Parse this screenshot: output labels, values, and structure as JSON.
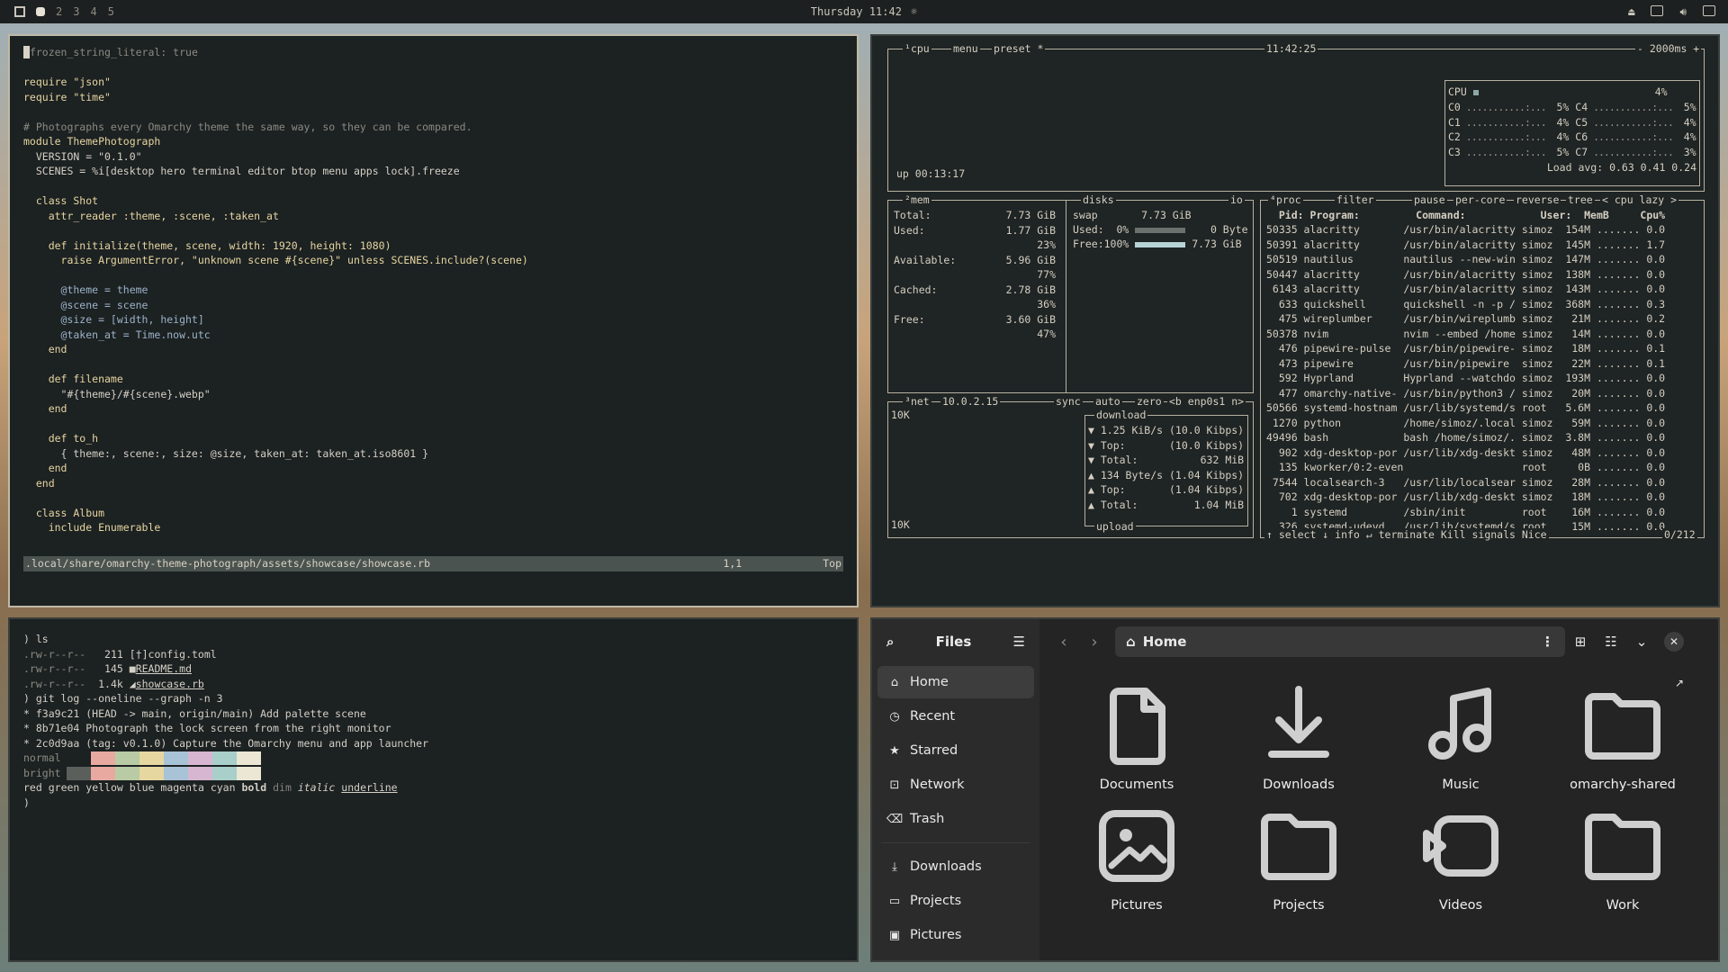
{
  "topbar": {
    "workspaces": [
      "2",
      "3",
      "4",
      "5"
    ],
    "clock": "Thursday 11:42"
  },
  "editor": {
    "lines": [
      "frozen_string_literal: true",
      "",
      "require \"json\"",
      "require \"time\"",
      "",
      "# Photographs every Omarchy theme the same way, so they can be compared.",
      "module ThemePhotograph",
      "  VERSION = \"0.1.0\"",
      "  SCENES = %i[desktop hero terminal editor btop menu apps lock].freeze",
      "",
      "  class Shot",
      "    attr_reader :theme, :scene, :taken_at",
      "",
      "    def initialize(theme, scene, width: 1920, height: 1080)",
      "      raise ArgumentError, \"unknown scene #{scene}\" unless SCENES.include?(scene)",
      "",
      "      @theme = theme",
      "      @scene = scene",
      "      @size = [width, height]",
      "      @taken_at = Time.now.utc",
      "    end",
      "",
      "    def filename",
      "      \"#{theme}/#{scene}.webp\"",
      "    end",
      "",
      "    def to_h",
      "      { theme:, scene:, size: @size, taken_at: taken_at.iso8601 }",
      "    end",
      "  end",
      "",
      "  class Album",
      "    include Enumerable"
    ],
    "status_path": ".local/share/omarchy-theme-photograph/assets/showcase/showcase.rb",
    "status_pos": "1,1",
    "status_scroll": "Top"
  },
  "btop": {
    "cpu": {
      "title": "cpu",
      "menu": "menu",
      "preset": "preset *",
      "time": "11:42:25",
      "interval": "- 2000ms +",
      "uptime": "up 00:13:17",
      "total_label": "CPU",
      "total": "4%",
      "cores": [
        {
          "name": "C0",
          "val": "5%"
        },
        {
          "name": "C4",
          "val": "5%"
        },
        {
          "name": "C1",
          "val": "4%"
        },
        {
          "name": "C5",
          "val": "4%"
        },
        {
          "name": "C2",
          "val": "4%"
        },
        {
          "name": "C6",
          "val": "4%"
        },
        {
          "name": "C3",
          "val": "5%"
        },
        {
          "name": "C7",
          "val": "3%"
        }
      ],
      "load": "Load avg: 0.63 0.41 0.24"
    },
    "mem": {
      "title": "mem",
      "disks": "disks",
      "io": "io",
      "rows": [
        "Total:            7.73 GiB",
        "Used:             1.77 GiB",
        "                       23%",
        "Available:        5.96 GiB",
        "                       77%",
        "Cached:           2.78 GiB",
        "                       36%",
        "Free:             3.60 GiB",
        "                       47%"
      ],
      "swap_title": "swap",
      "swap_total": "7.73 GiB",
      "swap_used": "Used:  0%",
      "swap_used_val": "0 Byte",
      "swap_free": "Free:100%",
      "swap_free_val": "7.73 GiB"
    },
    "net": {
      "title": "net",
      "ip": "10.0.2.15",
      "sync": "sync",
      "auto": "auto",
      "zero": "zero",
      "iface": "<b enp0s1 n>",
      "scale_top": "10K",
      "scale_bottom": "10K",
      "download": "download",
      "upload": "upload",
      "rows": [
        "▼ 1.25 KiB/s (10.0 Kibps)",
        "▼ Top:       (10.0 Kibps)",
        "▼ Total:          632 MiB",
        "▲ 134 Byte/s (1.04 Kibps)",
        "▲ Top:       (1.04 Kibps)",
        "▲ Total:         1.04 MiB"
      ]
    },
    "proc": {
      "title": "proc",
      "filter": "filter",
      "pause": "pause",
      "percore": "per-core",
      "reverse": "reverse",
      "tree": "tree",
      "sort": "< cpu lazy >",
      "header": "  Pid: Program:         Command:            User:  MemB     Cpu%",
      "rows": [
        "50335 alacritty       /usr/bin/alacritty simoz  154M ....... 0.0",
        "50391 alacritty       /usr/bin/alacritty simoz  145M ....... 1.7",
        "50519 nautilus        nautilus --new-win simoz  147M ....... 0.0",
        "50447 alacritty       /usr/bin/alacritty simoz  138M ....... 0.0",
        " 6143 alacritty       /usr/bin/alacritty simoz  143M ....... 0.0",
        "  633 quickshell      quickshell -n -p / simoz  368M ....... 0.3",
        "  475 wireplumber     /usr/bin/wireplumb simoz   21M ....... 0.2",
        "50378 nvim            nvim --embed /home simoz   14M ....... 0.0",
        "  476 pipewire-pulse  /usr/bin/pipewire- simoz   18M ....... 0.1",
        "  473 pipewire        /usr/bin/pipewire  simoz   22M ....... 0.1",
        "  592 Hyprland        Hyprland --watchdo simoz  193M ....... 0.0",
        "  477 omarchy-native- /usr/bin/python3 / simoz   20M ....... 0.0",
        "50566 systemd-hostnam /usr/lib/systemd/s root   5.6M ....... 0.0",
        " 1270 python          /home/simoz/.local simoz   59M ....... 0.0",
        "49496 bash            bash /home/simoz/. simoz  3.8M ....... 0.0",
        "  902 xdg-desktop-por /usr/lib/xdg-deskt simoz   48M ....... 0.0",
        "  135 kworker/0:2-even                   root     0B ....... 0.0",
        " 7544 localsearch-3   /usr/lib/localsear simoz   28M ....... 0.0",
        "  702 xdg-desktop-por /usr/lib/xdg-deskt simoz   18M ....... 0.0",
        "    1 systemd         /sbin/init         root    16M ....... 0.0",
        "  326 systemd-udevd   /usr/lib/systemd/s root    15M ....... 0.0"
      ],
      "footer": "↑ select ↓ info ↵ terminate  Kill  signals  Nice",
      "count": "0/212"
    }
  },
  "terminal": {
    "prompt1": ") ls",
    "ls": [
      {
        "perm": ".rw-r--r--",
        "size": "211",
        "icon": "[†]",
        "name": "config.toml"
      },
      {
        "perm": ".rw-r--r--",
        "size": "145",
        "icon": "■",
        "name": "README.md"
      },
      {
        "perm": ".rw-r--r--",
        "size": "1.4k",
        "icon": "◢",
        "name": "showcase.rb"
      }
    ],
    "prompt2": ") git log --oneline --graph -n 3",
    "log": [
      "* f3a9c21 (HEAD -> main, origin/main) Add palette scene",
      "* 8b71e04 Photograph the lock screen from the right monitor",
      "* 2c0d9aa (tag: v0.1.0) Capture the Omarchy menu and app launcher"
    ],
    "normal_label": "normal",
    "bright_label": "bright",
    "palette_normal": [
      "#1c2122",
      "#e8a9a0",
      "#b8cba4",
      "#e6d6a0",
      "#a9c3d6",
      "#d6b6d0",
      "#a8cfc9",
      "#ece6d4"
    ],
    "palette_bright": [
      "#5a5f5b",
      "#e8a9a0",
      "#b8cba4",
      "#e6d6a0",
      "#a9c3d6",
      "#d6b6d0",
      "#a8cfc9",
      "#ece6d4"
    ],
    "styles": [
      "red",
      "green",
      "yellow",
      "blue",
      "magenta",
      "cyan",
      "bold",
      "dim",
      "italic",
      "underline"
    ],
    "prompt3": ")"
  },
  "files": {
    "title": "Files",
    "location": "Home",
    "sidebar": [
      "Home",
      "Recent",
      "Starred",
      "Network",
      "Trash"
    ],
    "bookmarks": [
      "Downloads",
      "Projects",
      "Pictures"
    ],
    "items": [
      "Documents",
      "Downloads",
      "Music",
      "omarchy-shared",
      "Pictures",
      "Projects",
      "Videos",
      "Work"
    ]
  }
}
